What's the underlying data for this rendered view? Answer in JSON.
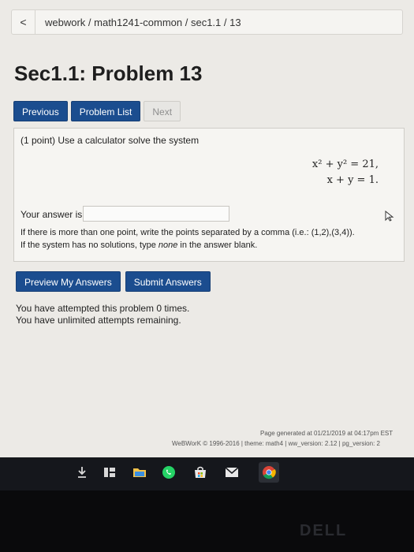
{
  "breadcrumb": {
    "back_glyph": "<",
    "path": "webwork / math1241-common / sec1.1 / 13"
  },
  "page": {
    "title": "Sec1.1: Problem 13"
  },
  "nav": {
    "previous": "Previous",
    "problem_list": "Problem List",
    "next": "Next"
  },
  "problem": {
    "intro": "(1 point) Use a calculator solve the system",
    "eq1": "x² + y² = 21,",
    "eq2": "x + y = 1.",
    "answer_label": "Your answer is",
    "answer_value": "",
    "hint1": "If there is more than one point, write the points separated by a comma (i.e.: (1,2),(3,4)).",
    "hint2_pre": "If the system has no solutions, type ",
    "hint2_em": "none",
    "hint2_post": " in the answer blank."
  },
  "actions": {
    "preview": "Preview My Answers",
    "submit": "Submit Answers"
  },
  "status": {
    "attempts": "You have attempted this problem 0 times.",
    "remaining": "You have unlimited attempts remaining."
  },
  "footer": {
    "generated": "Page generated at 01/21/2019 at 04:17pm EST",
    "copyright": "WeBWorK © 1996-2016 | theme: math4 | ww_version: 2.12 | pg_version: 2"
  },
  "taskbar": {
    "icons": [
      "download-icon",
      "tiles-icon",
      "folder-icon",
      "whatsapp-icon",
      "store-icon",
      "mail-icon",
      "chrome-icon"
    ]
  },
  "brand": {
    "logo": "DELL"
  },
  "colors": {
    "primary_button": "#1b4d8f",
    "page_bg": "#eceae6",
    "taskbar_bg": "#15171c"
  }
}
